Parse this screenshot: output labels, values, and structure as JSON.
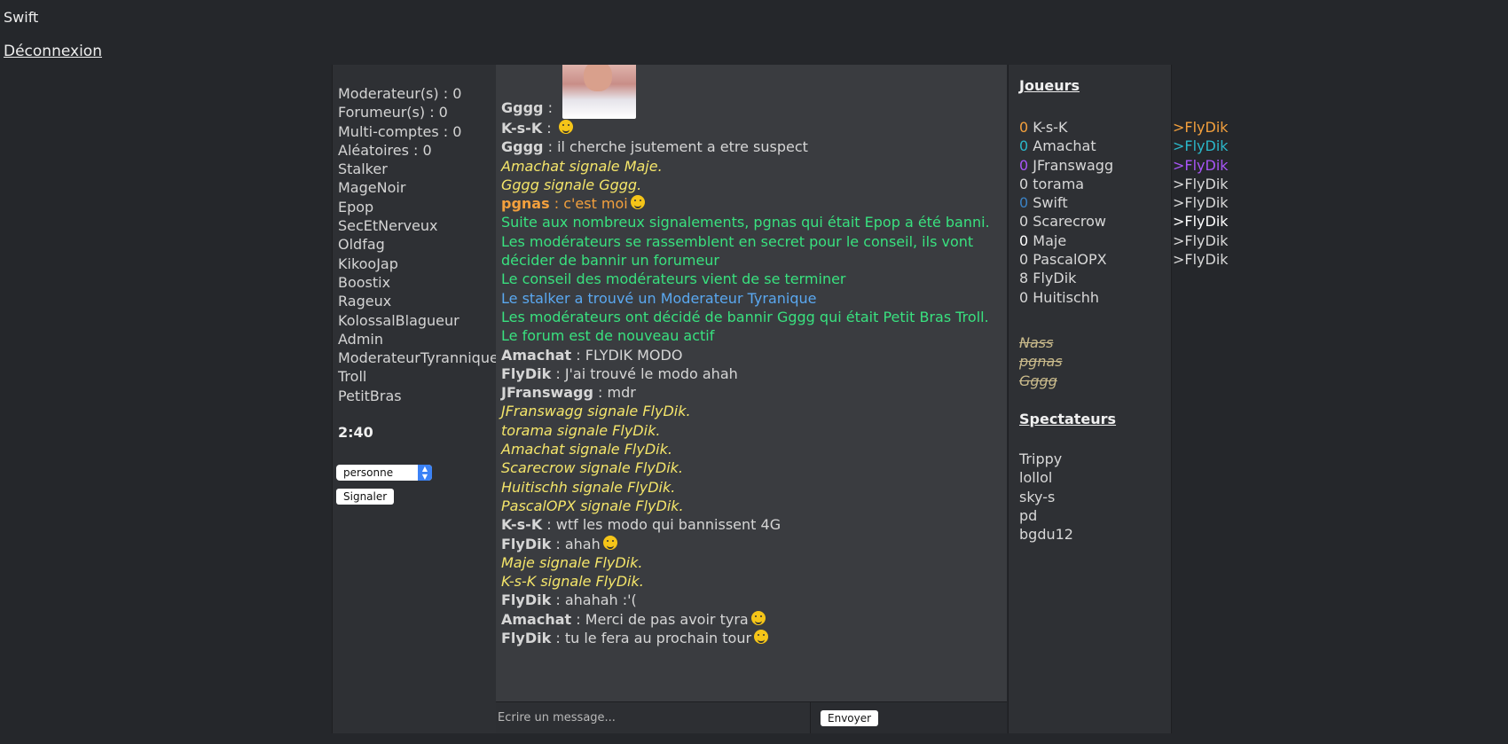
{
  "header": {
    "username": "Swift",
    "logout": "Déconnexion"
  },
  "roles": [
    "Moderateur(s) : 0",
    "Forumeur(s) : 0",
    "Multi-comptes : 0",
    "Aléatoires : 0",
    "Stalker",
    "MageNoir",
    "Epop",
    "SecEtNerveux",
    "Oldfag",
    "KikooJap",
    "Boostix",
    "Rageux",
    "KolossalBlagueur",
    "Admin",
    "ModerateurTyrannique",
    "Troll",
    "PetitBras"
  ],
  "timer": "2:40",
  "select": {
    "value": "personne"
  },
  "signal_button": "Signaler",
  "chat": {
    "messages": [
      {
        "type": "user",
        "author": "Gggg",
        "text": "",
        "image": true
      },
      {
        "type": "user",
        "author": "K-s-K",
        "text": "",
        "emoji": "worried-emoji"
      },
      {
        "type": "user",
        "author": "Gggg",
        "text": "il cherche jsutement a etre suspect"
      },
      {
        "type": "signal",
        "text": "Amachat signale Maje."
      },
      {
        "type": "signal",
        "text": "Gggg signale Gggg."
      },
      {
        "type": "user-orange",
        "author": "pgnas",
        "text": "c'est moi",
        "emoji": "grin-emoji"
      },
      {
        "type": "system",
        "text": "Suite aux nombreux signalements, pgnas qui était Epop a été banni."
      },
      {
        "type": "system",
        "text": "Les modérateurs se rassemblent en secret pour le conseil, ils vont"
      },
      {
        "type": "system",
        "text": "décider de bannir un forumeur"
      },
      {
        "type": "system",
        "text": "Le conseil des modérateurs vient de se terminer"
      },
      {
        "type": "info",
        "text": "Le stalker a trouvé un Moderateur Tyranique"
      },
      {
        "type": "system",
        "text": "Les modérateurs ont décidé de bannir Gggg qui était Petit Bras Troll."
      },
      {
        "type": "system",
        "text": "Le forum est de nouveau actif"
      },
      {
        "type": "user",
        "author": "Amachat",
        "text": "FLYDIK MODO"
      },
      {
        "type": "user",
        "author": "FlyDik",
        "text": "J'ai trouvé le modo ahah"
      },
      {
        "type": "user",
        "author": "JFranswagg",
        "text": "mdr"
      },
      {
        "type": "signal",
        "text": "JFranswagg signale FlyDik."
      },
      {
        "type": "signal",
        "text": "torama signale FlyDik."
      },
      {
        "type": "signal",
        "text": "Amachat signale FlyDik."
      },
      {
        "type": "signal",
        "text": "Scarecrow signale FlyDik."
      },
      {
        "type": "signal",
        "text": "Huitischh signale FlyDik."
      },
      {
        "type": "signal",
        "text": "PascalOPX signale FlyDik."
      },
      {
        "type": "user",
        "author": "K-s-K",
        "text": "wtf les modo qui bannissent 4G"
      },
      {
        "type": "user",
        "author": "FlyDik",
        "text": "ahah",
        "emoji": "worried-emoji"
      },
      {
        "type": "signal",
        "text": "Maje signale FlyDik."
      },
      {
        "type": "signal",
        "text": "K-s-K signale FlyDik."
      },
      {
        "type": "user",
        "author": "FlyDik",
        "text": "ahahah :'("
      },
      {
        "type": "user",
        "author": "Amachat",
        "text": "Merci de pas avoir tyra",
        "emoji": "smile-emoji"
      },
      {
        "type": "user",
        "author": "FlyDik",
        "text": "tu le fera au prochain tour",
        "emoji": "wink-emoji"
      }
    ],
    "input_placeholder": "Ecrire un message...",
    "send_button": "Envoyer"
  },
  "players": {
    "title": "Joueurs",
    "list": [
      {
        "score": "0",
        "name": "K-s-K",
        "score_color": "#f3a03d"
      },
      {
        "score": "0",
        "name": "Amachat",
        "score_color": "#2bb7c9"
      },
      {
        "score": "0",
        "name": "JFranswagg",
        "score_color": "#a855f7"
      },
      {
        "score": "0",
        "name": "torama",
        "score_color": "#d8d8d8"
      },
      {
        "score": "0",
        "name": "Swift",
        "score_color": "#3b82c4"
      },
      {
        "score": "0",
        "name": "Scarecrow",
        "score_color": "#d8d8d8"
      },
      {
        "score": "0",
        "name": "Maje",
        "score_color": "#ffffff"
      },
      {
        "score": "0",
        "name": "PascalOPX",
        "score_color": "#d8d8d8"
      },
      {
        "score": "8",
        "name": "FlyDik",
        "score_color": "#d8d8d8"
      },
      {
        "score": "0",
        "name": "Huitischh",
        "score_color": "#d8d8d8"
      }
    ],
    "dead": [
      "Nass",
      "pgnas",
      "Gggg"
    ]
  },
  "votes": [
    {
      "text": ">FlyDik",
      "color": "#f3a03d"
    },
    {
      "text": ">FlyDik",
      "color": "#2bb7c9"
    },
    {
      "text": ">FlyDik",
      "color": "#a855f7"
    },
    {
      "text": ">FlyDik",
      "color": "#d8d8d8"
    },
    {
      "text": ">FlyDik",
      "color": "#d8d8d8"
    },
    {
      "text": ">FlyDik",
      "color": "#ffffff"
    },
    {
      "text": ">FlyDik",
      "color": "#d8d8d8"
    },
    {
      "text": ">FlyDik",
      "color": "#d8d8d8"
    }
  ],
  "spectators": {
    "title": "Spectateurs",
    "list": [
      "Trippy",
      "lollol",
      "sky-s",
      "pd",
      "bgdu12"
    ]
  }
}
